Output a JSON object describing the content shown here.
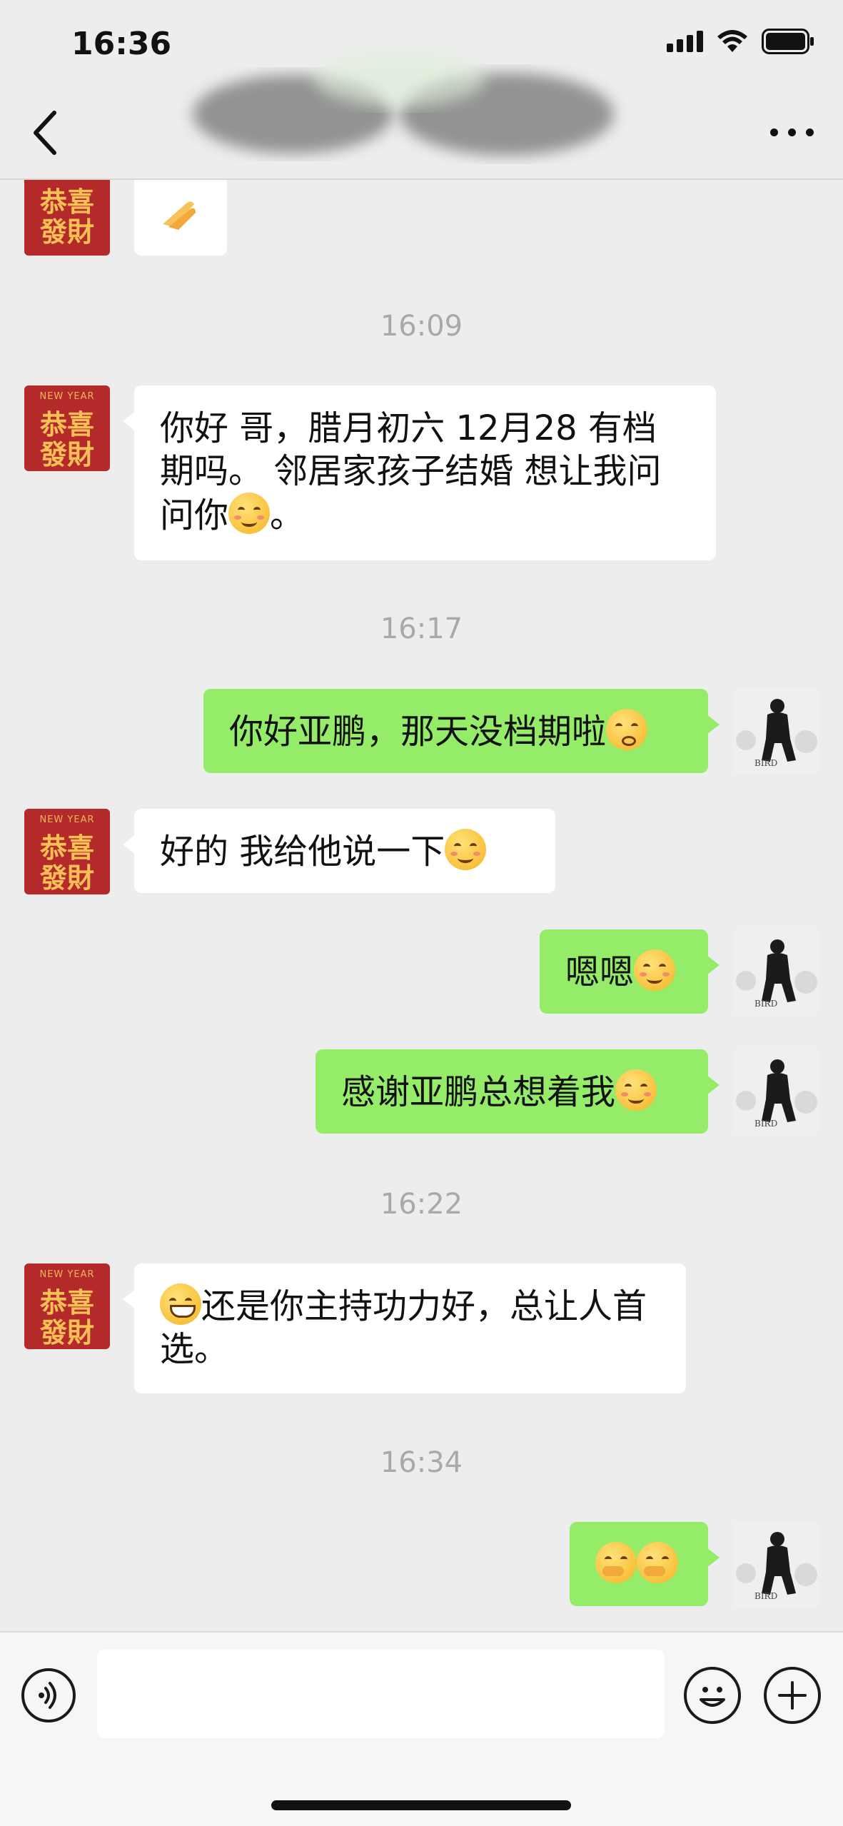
{
  "status_bar": {
    "time": "16:36"
  },
  "messages": [
    {
      "type": "time",
      "text": "16:09"
    },
    {
      "type": "msg",
      "side": "left",
      "text": "你好 哥，腊月初六  12月28 有档期吗。 邻居家孩子结婚 想让我问问你",
      "emoji_after": "smile-emoji",
      "tail": "。"
    },
    {
      "type": "time",
      "text": "16:17"
    },
    {
      "type": "msg",
      "side": "right",
      "text": "你好亚鹏，那天没档期啦",
      "emoji_after": "pleading-emoji"
    },
    {
      "type": "msg",
      "side": "left",
      "text": "好的   我给他说一下",
      "emoji_after": "smile-emoji"
    },
    {
      "type": "msg",
      "side": "right",
      "text": "嗯嗯",
      "emoji_after": "smile-emoji"
    },
    {
      "type": "msg",
      "side": "right",
      "text": "感谢亚鹏总想着我",
      "emoji_after": "smile-emoji"
    },
    {
      "type": "time",
      "text": "16:22"
    },
    {
      "type": "msg",
      "side": "left",
      "emoji_before": "grin-emoji",
      "text": "还是你主持功力好，总让人首选。"
    },
    {
      "type": "time",
      "text": "16:34"
    },
    {
      "type": "msg",
      "side": "right",
      "emoji_only": [
        "hand-over-mouth-emoji",
        "hand-over-mouth-emoji"
      ]
    }
  ],
  "avatar_left": {
    "top": "NEW YEAR",
    "line1": "恭喜",
    "line2": "發財"
  },
  "avatar_right": {
    "caption": "BIRD"
  },
  "input": {
    "placeholder": ""
  }
}
